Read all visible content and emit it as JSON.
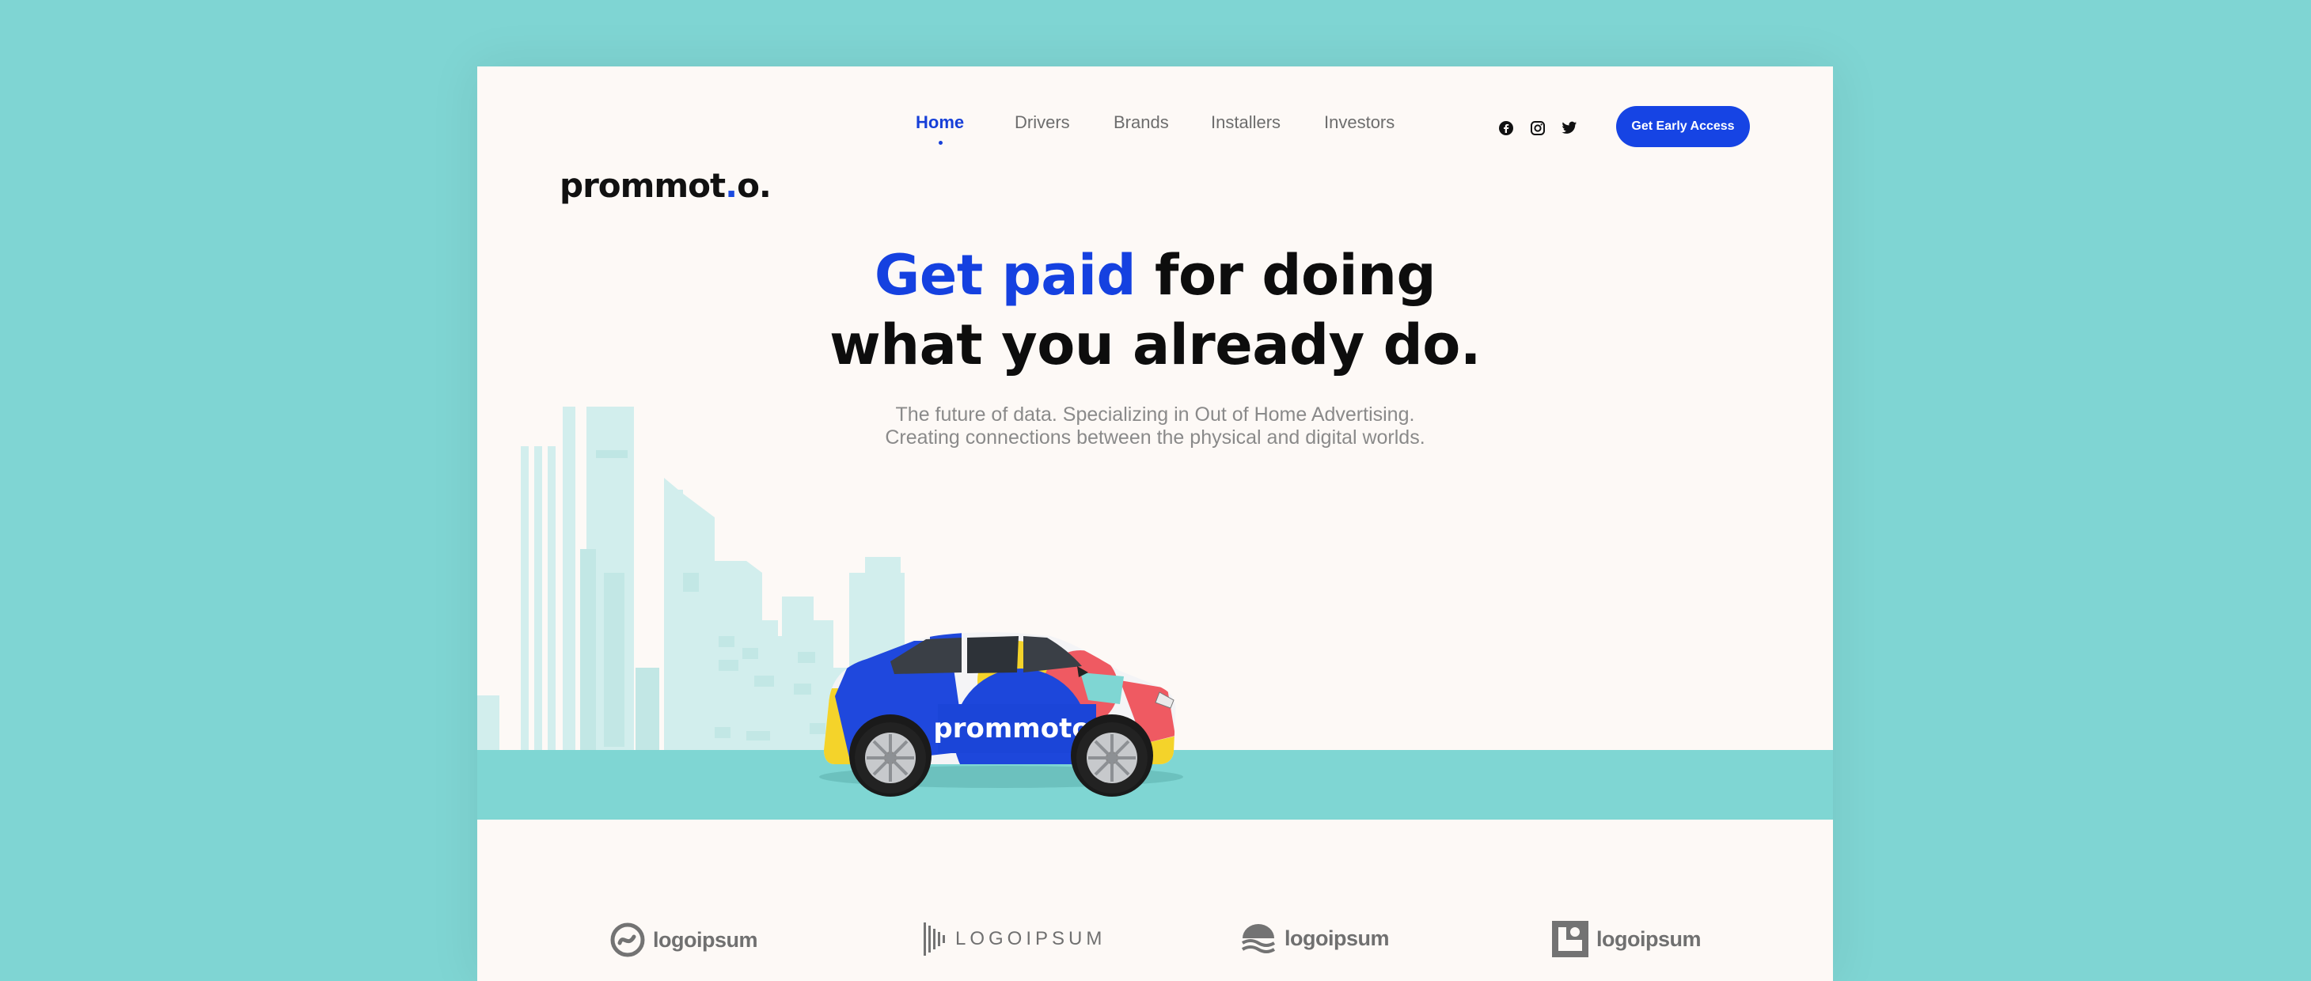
{
  "brand": {
    "logo_main": "prommot",
    "logo_dot": ".",
    "logo_end": "o."
  },
  "nav": {
    "items": [
      {
        "label": "Home",
        "active": true
      },
      {
        "label": "Drivers"
      },
      {
        "label": "Brands"
      },
      {
        "label": "Installers"
      },
      {
        "label": "Investors"
      }
    ]
  },
  "social": [
    "facebook-icon",
    "instagram-icon",
    "twitter-icon"
  ],
  "cta_label": "Get Early Access",
  "hero": {
    "headline_accent": "Get paid",
    "headline_rest": " for doing",
    "headline_line2": "what you already do.",
    "subtitle_line1": "The future of data. Specializing in Out of Home Advertising.",
    "subtitle_line2": "Creating connections between the physical and digital worlds."
  },
  "car_wrap_text": "prommoto.",
  "partners": [
    {
      "name": "logoipsum",
      "icon": "swirl-circle-icon"
    },
    {
      "name": "LOGOIPSUM",
      "icon": "barcode-bars-icon"
    },
    {
      "name": "logoipsum",
      "icon": "waves-cloud-icon"
    },
    {
      "name": "logoipsum",
      "icon": "square-frame-icon"
    }
  ],
  "colors": {
    "background": "#7fd5d3",
    "page": "#fdf9f6",
    "accent": "#1541e0",
    "ground": "#7fd6d3",
    "skyline": "#cfeceb"
  }
}
